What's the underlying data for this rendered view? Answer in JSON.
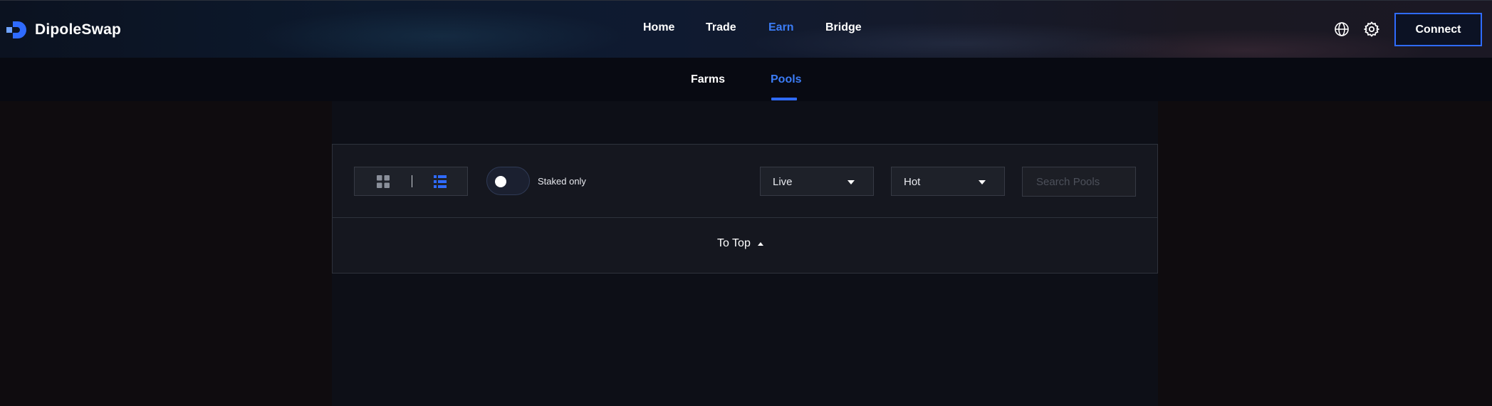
{
  "brand": {
    "name": "DipoleSwap",
    "accent": "#2f6bff"
  },
  "nav": {
    "items": [
      {
        "label": "Home",
        "active": false
      },
      {
        "label": "Trade",
        "active": false
      },
      {
        "label": "Earn",
        "active": true
      },
      {
        "label": "Bridge",
        "active": false
      }
    ]
  },
  "header_actions": {
    "language_icon": "globe-icon",
    "settings_icon": "gear-icon",
    "connect_label": "Connect"
  },
  "subnav": {
    "items": [
      {
        "label": "Farms",
        "active": false
      },
      {
        "label": "Pools",
        "active": true
      }
    ]
  },
  "filters": {
    "view_modes": [
      "grid-view-icon",
      "list-view-icon"
    ],
    "active_view": "list",
    "staked_only": {
      "label": "Staked only",
      "checked": false
    },
    "status_select": {
      "value": "Live"
    },
    "sort_select": {
      "value": "Hot"
    },
    "search": {
      "placeholder": "Search Pools",
      "value": ""
    }
  },
  "to_top": {
    "label": "To Top"
  }
}
